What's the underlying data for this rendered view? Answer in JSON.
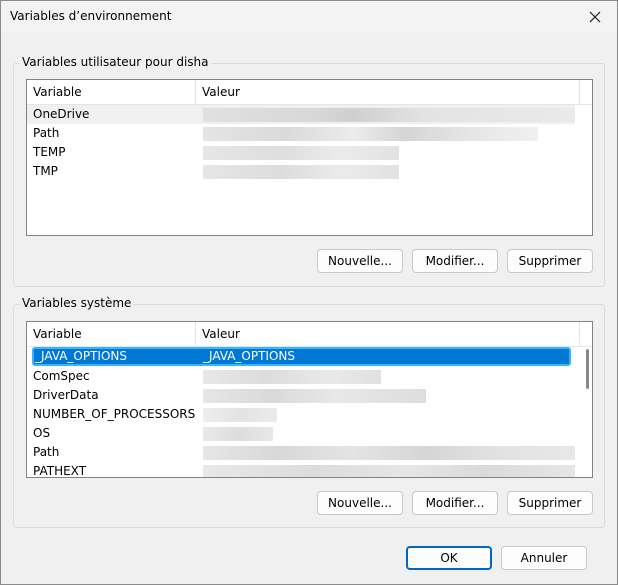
{
  "window": {
    "title": "Variables d’environnement",
    "close_icon": "close-icon"
  },
  "user": {
    "group_label": "Variables utilisateur pour disha",
    "columns": [
      "Variable",
      "Valeur"
    ],
    "rows": [
      {
        "name": "OneDrive"
      },
      {
        "name": "Path"
      },
      {
        "name": "TEMP"
      },
      {
        "name": "TMP"
      }
    ],
    "buttons": {
      "new": "Nouvelle...",
      "edit": "Modifier...",
      "delete": "Supprimer"
    }
  },
  "system": {
    "group_label": "Variables système",
    "columns": [
      "Variable",
      "Valeur"
    ],
    "rows": [
      {
        "name": "_JAVA_OPTIONS",
        "value": "_JAVA_OPTIONS",
        "selected": true
      },
      {
        "name": "ComSpec"
      },
      {
        "name": "DriverData"
      },
      {
        "name": "NUMBER_OF_PROCESSORS"
      },
      {
        "name": "OS"
      },
      {
        "name": "Path"
      },
      {
        "name": "PATHEXT"
      }
    ],
    "buttons": {
      "new": "Nouvelle...",
      "edit": "Modifier...",
      "delete": "Supprimer"
    }
  },
  "footer": {
    "ok": "OK",
    "cancel": "Annuler"
  },
  "colors": {
    "selection": "#0078d4",
    "selection_border": "#39b4ff",
    "primary_border": "#0067c0"
  }
}
